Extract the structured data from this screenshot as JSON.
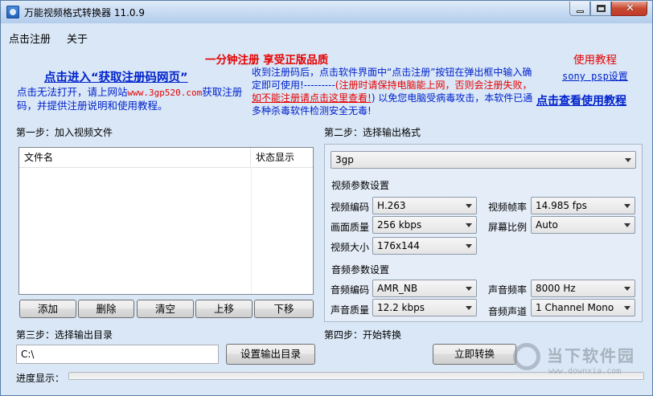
{
  "window": {
    "title": "万能视频格式转换器 11.0.9",
    "close_glyph": "✕"
  },
  "menu": {
    "register": "点击注册",
    "about": "关于"
  },
  "promo": {
    "headline": "一分钟注册  享受正版品质",
    "reg_link": "点击进入“获取注册码网页”",
    "note_a": "点击无法打开，请上网站",
    "site": "www.3gp520.com",
    "note_b": "获取注册码，并提供注册说明和使用教程。",
    "mid_a": "收到注册码后，点击软件界面中“点击注册”按钮在弹出框中输入确定即可使用!---------",
    "mid_red": "(注册时请保持电脑能上网，否则会注册失败，",
    "mid_underline": "如不能注册请点击这里查看!",
    "mid_b": ") 以免您电脑受病毒攻击，本软件已通多种杀毒软件检测安全无毒!",
    "tutorial": "使用教程",
    "sony": "sony psp设置",
    "tutorial_link": "点击查看使用教程"
  },
  "step1": {
    "label": "第一步：加入视频文件",
    "col_name": "文件名",
    "col_status": "状态显示",
    "buttons": [
      "添加",
      "删除",
      "清空",
      "上移",
      "下移"
    ]
  },
  "step2": {
    "label": "第二步：选择输出格式",
    "format": "3gp",
    "video_section": "视频参数设置",
    "video_codec_label": "视频编码",
    "video_codec": "H.263",
    "frame_rate_label": "视频帧率",
    "frame_rate": "14.985 fps",
    "quality_label": "画面质量",
    "quality": "256 kbps",
    "aspect_label": "屏幕比例",
    "aspect": "Auto",
    "size_label": "视频大小",
    "size": "176x144",
    "audio_section": "音频参数设置",
    "audio_codec_label": "音频编码",
    "audio_codec": "AMR_NB",
    "sample_rate_label": "声音频率",
    "sample_rate": "8000 Hz",
    "audio_quality_label": "声音质量",
    "audio_quality": "12.2 kbps",
    "channels_label": "音频声道",
    "channels": "1 Channel Mono"
  },
  "step3": {
    "label": "第三步：选择输出目录",
    "path": "C:\\",
    "button": "设置输出目录"
  },
  "step4": {
    "label": "第四步：开始转换",
    "button": "立即转换"
  },
  "progress": {
    "label": "进度显示：",
    "value_pct": 0
  },
  "watermark": {
    "name": "当下软件园",
    "url": "www.downxia.com"
  }
}
